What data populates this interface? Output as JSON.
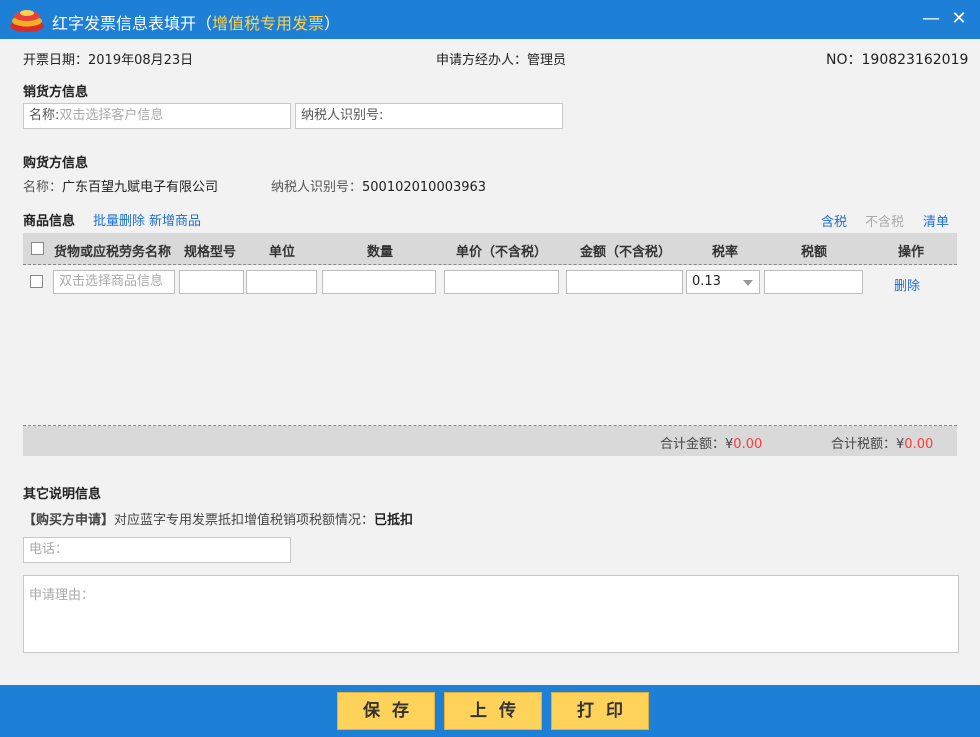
{
  "window": {
    "title": "红字发票信息表填开",
    "title_paren_open": "（",
    "subtitle": "增值税专用发票",
    "title_paren_close": "）",
    "minimize_glyph": "—",
    "close_glyph": "✕"
  },
  "meta": {
    "date_label": "开票日期：",
    "date_value": "2019年08月23日",
    "applicant_label": "申请方经办人：",
    "applicant_value": "管理员",
    "no_label": "NO：",
    "no_value": "190823162019"
  },
  "seller": {
    "heading": "销货方信息",
    "name_label": "名称:",
    "name_placeholder": "双击选择客户信息",
    "tax_id_label": "纳税人识别号:"
  },
  "buyer": {
    "heading": "购货方信息",
    "name_label": "名称：",
    "name_value": "广东百望九赋电子有限公司",
    "tax_id_label": "纳税人识别号：",
    "tax_id_value": "500102010003963"
  },
  "goods": {
    "heading": "商品信息",
    "batch_delete": "批量删除",
    "add_goods": "新增商品",
    "tax_included": "含税",
    "tax_excluded": "不含税",
    "list": "清单",
    "columns": [
      "货物或应税劳务名称",
      "规格型号",
      "单位",
      "数量",
      "单价（不含税）",
      "金额（不含税）",
      "税率",
      "税额",
      "操作"
    ],
    "row": {
      "name_placeholder": "双击选择商品信息",
      "tax_rate": "0.13",
      "delete": "删除"
    },
    "total_amount_label": "合计金额：",
    "total_amount_currency": "¥",
    "total_amount_value": "0.00",
    "total_tax_label": "合计税额：",
    "total_tax_currency": "¥",
    "total_tax_value": "0.00"
  },
  "other": {
    "heading": "其它说明信息",
    "buyer_request_tag": "【购买方申请】",
    "buyer_request_text": "对应蓝字专用发票抵扣增值税销项税额情况：",
    "buyer_request_status": "已抵扣",
    "phone_placeholder": "电话：",
    "reason_placeholder": "申请理由："
  },
  "footer": {
    "save": "保存",
    "upload": "上传",
    "print": "打印"
  },
  "colors": {
    "titlebar": "#1e7fd6",
    "subtitle": "#ffd24a",
    "link": "#1e6fd1",
    "button": "#ffd35a",
    "amount": "#ff3b3b"
  },
  "icons": {
    "app_logo": "app-logo-icon",
    "dropdown": "chevron-down-icon"
  }
}
